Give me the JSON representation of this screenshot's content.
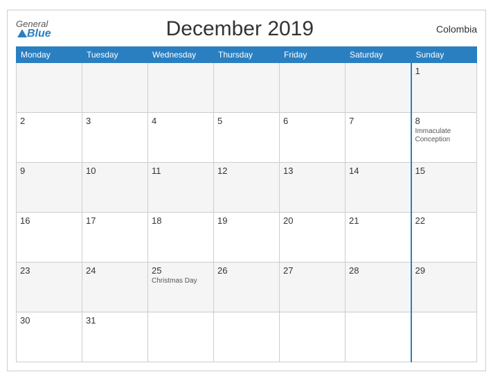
{
  "header": {
    "logo_general": "General",
    "logo_blue": "Blue",
    "title": "December 2019",
    "country": "Colombia"
  },
  "weekdays": [
    "Monday",
    "Tuesday",
    "Wednesday",
    "Thursday",
    "Friday",
    "Saturday",
    "Sunday"
  ],
  "rows": [
    [
      {
        "day": "",
        "holiday": ""
      },
      {
        "day": "",
        "holiday": ""
      },
      {
        "day": "",
        "holiday": ""
      },
      {
        "day": "",
        "holiday": ""
      },
      {
        "day": "",
        "holiday": ""
      },
      {
        "day": "",
        "holiday": ""
      },
      {
        "day": "1",
        "holiday": ""
      }
    ],
    [
      {
        "day": "2",
        "holiday": ""
      },
      {
        "day": "3",
        "holiday": ""
      },
      {
        "day": "4",
        "holiday": ""
      },
      {
        "day": "5",
        "holiday": ""
      },
      {
        "day": "6",
        "holiday": ""
      },
      {
        "day": "7",
        "holiday": ""
      },
      {
        "day": "8",
        "holiday": "Immaculate Conception"
      }
    ],
    [
      {
        "day": "9",
        "holiday": ""
      },
      {
        "day": "10",
        "holiday": ""
      },
      {
        "day": "11",
        "holiday": ""
      },
      {
        "day": "12",
        "holiday": ""
      },
      {
        "day": "13",
        "holiday": ""
      },
      {
        "day": "14",
        "holiday": ""
      },
      {
        "day": "15",
        "holiday": ""
      }
    ],
    [
      {
        "day": "16",
        "holiday": ""
      },
      {
        "day": "17",
        "holiday": ""
      },
      {
        "day": "18",
        "holiday": ""
      },
      {
        "day": "19",
        "holiday": ""
      },
      {
        "day": "20",
        "holiday": ""
      },
      {
        "day": "21",
        "holiday": ""
      },
      {
        "day": "22",
        "holiday": ""
      }
    ],
    [
      {
        "day": "23",
        "holiday": ""
      },
      {
        "day": "24",
        "holiday": ""
      },
      {
        "day": "25",
        "holiday": "Christmas Day"
      },
      {
        "day": "26",
        "holiday": ""
      },
      {
        "day": "27",
        "holiday": ""
      },
      {
        "day": "28",
        "holiday": ""
      },
      {
        "day": "29",
        "holiday": ""
      }
    ],
    [
      {
        "day": "30",
        "holiday": ""
      },
      {
        "day": "31",
        "holiday": ""
      },
      {
        "day": "",
        "holiday": ""
      },
      {
        "day": "",
        "holiday": ""
      },
      {
        "day": "",
        "holiday": ""
      },
      {
        "day": "",
        "holiday": ""
      },
      {
        "day": "",
        "holiday": ""
      }
    ]
  ]
}
